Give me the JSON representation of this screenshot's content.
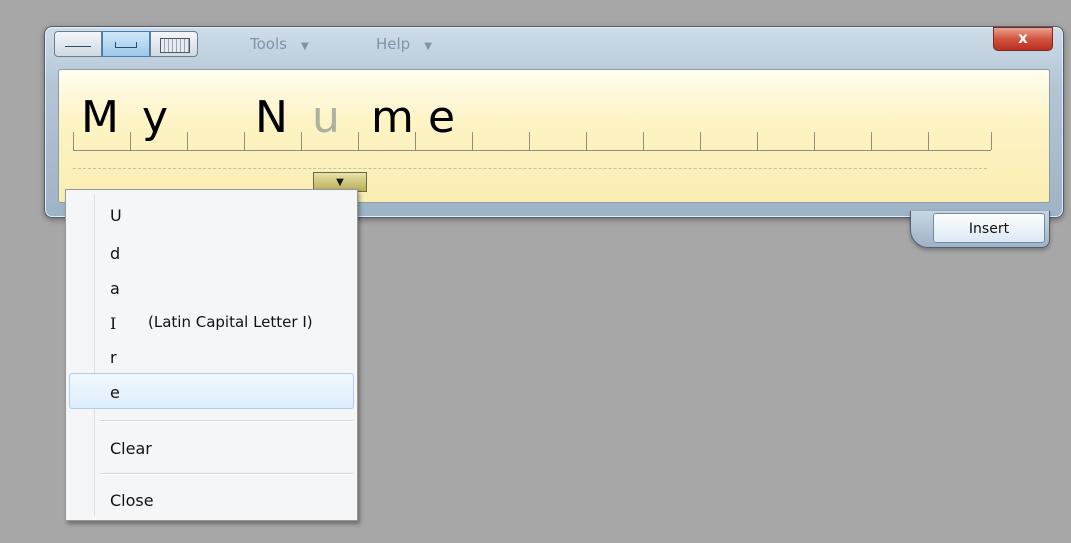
{
  "toolbar": {
    "tabs": [
      {
        "name": "writing-pad",
        "active": false
      },
      {
        "name": "character-pad",
        "active": true
      },
      {
        "name": "on-screen-keyboard",
        "active": false
      }
    ],
    "tools_label": "Tools",
    "help_label": "Help",
    "close_label": "x"
  },
  "writing_panel": {
    "characters": [
      "M",
      "y",
      " ",
      "N",
      "u",
      "m",
      "e"
    ],
    "corrected_char_index": 4
  },
  "insert_label": "Insert",
  "dropdown": {
    "alternates": [
      "U",
      "d",
      "a",
      "I",
      "r",
      "e"
    ],
    "alternate_hint": "(Latin Capital Letter I)",
    "selected": "e",
    "clear_label": "Clear",
    "close_label": "Close"
  }
}
